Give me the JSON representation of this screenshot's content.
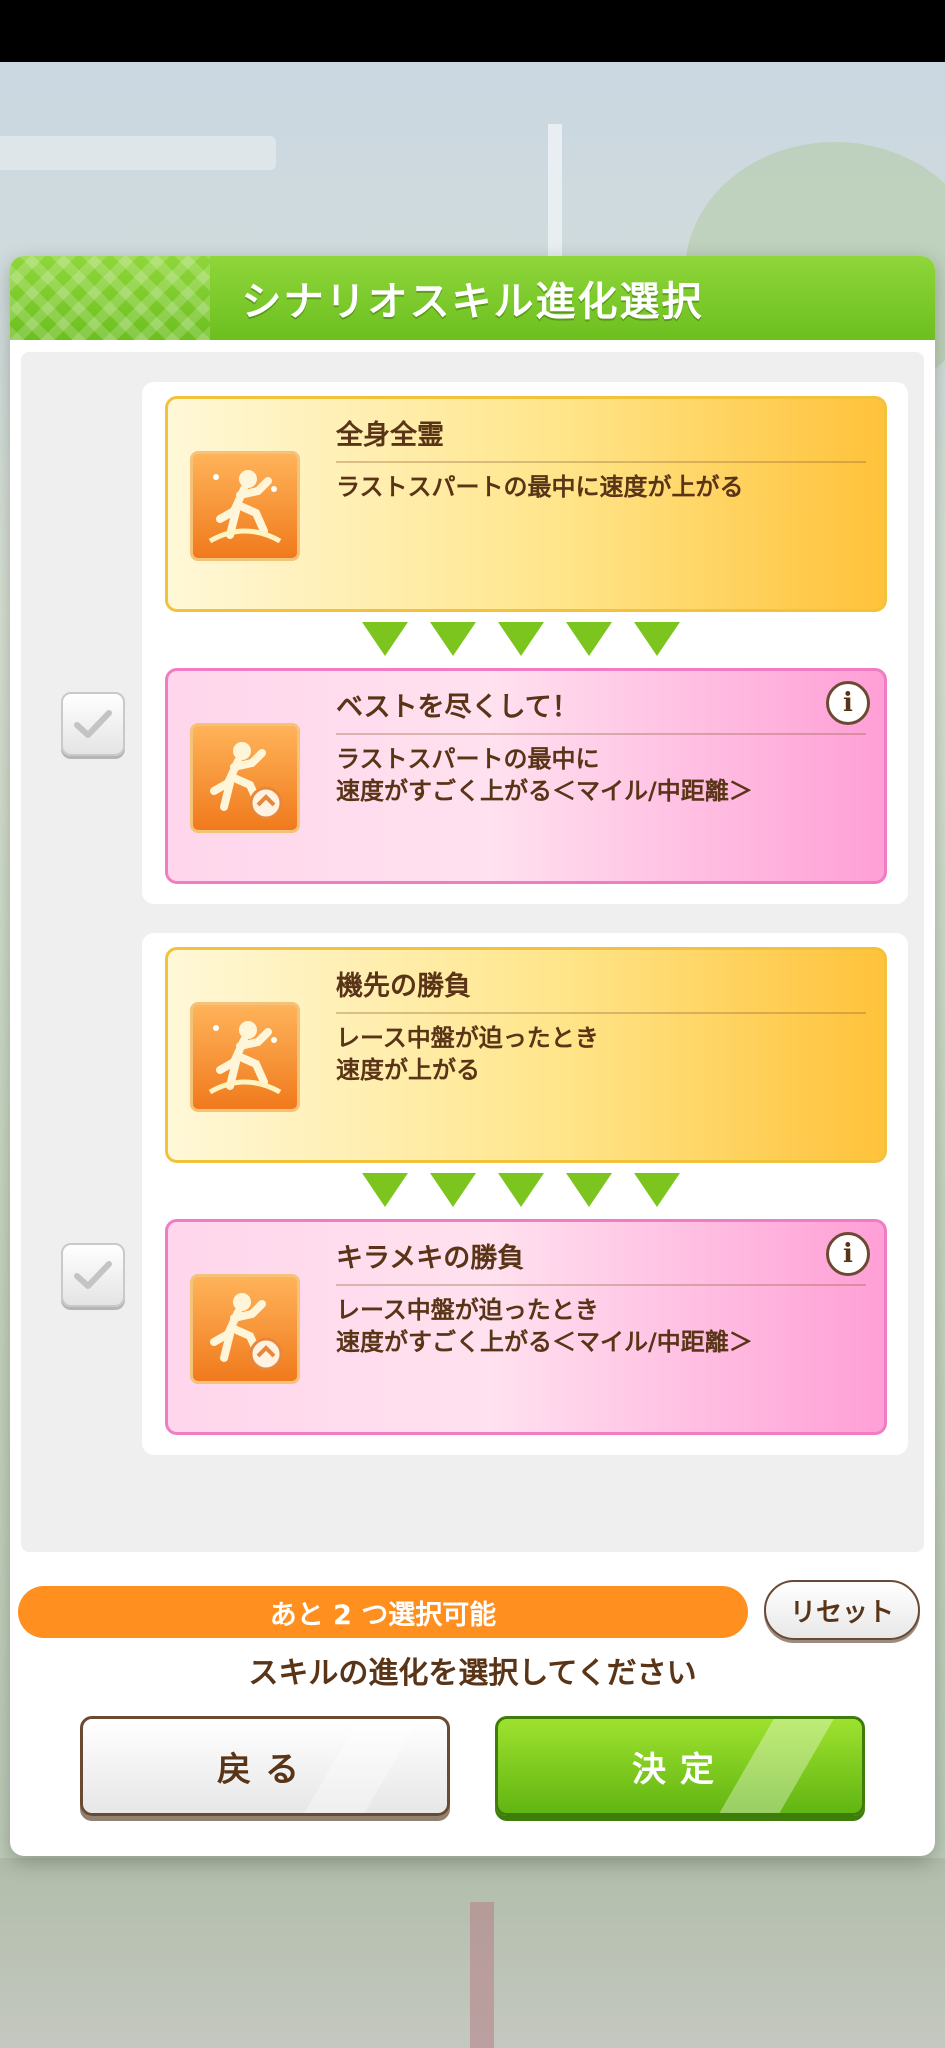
{
  "dialog": {
    "title": "シナリオスキル進化選択"
  },
  "groups": [
    {
      "base": {
        "name": "全身全霊",
        "desc_line1": "ラストスパートの最中に速度が上がる",
        "desc_line2": ""
      },
      "evolved": {
        "name": "ベストを尽くして！",
        "desc_line1": "ラストスパートの最中に",
        "desc_line2": "速度がすごく上がる＜マイル/中距離＞",
        "info_label": "i"
      },
      "checked": true
    },
    {
      "base": {
        "name": "機先の勝負",
        "desc_line1": "レース中盤が迫ったとき",
        "desc_line2": "速度が上がる"
      },
      "evolved": {
        "name": "キラメキの勝負",
        "desc_line1": "レース中盤が迫ったとき",
        "desc_line2": "速度がすごく上がる＜マイル/中距離＞",
        "info_label": "i"
      },
      "checked": true
    }
  ],
  "footer": {
    "remaining_label": "あと 2 つ選択可能",
    "reset_label": "リセット",
    "instruction": "スキルの進化を選択してください",
    "back_label": "戻る",
    "confirm_label": "決定"
  },
  "colors": {
    "header_green": "#6cbf1f",
    "base_card_yellow": "#ffc23a",
    "evolved_card_pink": "#ff9fd6",
    "remaining_orange": "#ff8f1e",
    "text_brown": "#5a3417"
  },
  "icons": {
    "skill_icon": "running-figure-icon",
    "evolution_badge": "evolution-badge-icon",
    "arrow": "triangle-down-icon",
    "check": "check-icon",
    "info": "info-icon"
  }
}
